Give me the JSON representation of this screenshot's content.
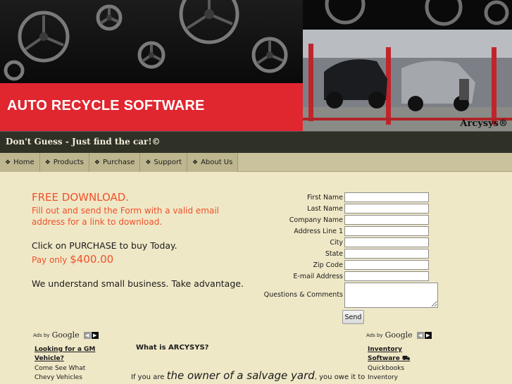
{
  "header": {
    "brand_title": "AUTO RECYCLE SOFTWARE",
    "photo_brand": "Arcysys®"
  },
  "slogan": "Don't Guess - Just find the car!©",
  "nav": {
    "items": [
      {
        "label": "Home"
      },
      {
        "label": "Products"
      },
      {
        "label": "Purchase"
      },
      {
        "label": "Support"
      },
      {
        "label": "About Us"
      }
    ]
  },
  "promo": {
    "free_download": "FREE DOWNLOAD.",
    "fill_line_1": "Fill out and send the Form with a valid email",
    "fill_line_2": "address for a link to download.",
    "click_purchase": "Click on PURCHASE to buy Today.",
    "pay_only": "Pay only",
    "price": "$400.00",
    "small_business": "We understand small business. Take advantage."
  },
  "form": {
    "fields": [
      {
        "label": "First Name",
        "value": ""
      },
      {
        "label": "Last Name",
        "value": ""
      },
      {
        "label": "Company Name",
        "value": ""
      },
      {
        "label": "Address Line 1",
        "value": ""
      },
      {
        "label": "City",
        "value": ""
      },
      {
        "label": "State",
        "value": ""
      },
      {
        "label": "Zip Code",
        "value": ""
      },
      {
        "label": "E-mail Address",
        "value": ""
      }
    ],
    "comments_label": "Questions & Comments",
    "send_label": "Send"
  },
  "ads_left": {
    "ads_by": "Ads by",
    "google": "Google",
    "link_line_1": "Looking for a GM",
    "link_line_2": "Vehicle?",
    "text_1": "Come See What",
    "text_2": "Chevy Vehicles"
  },
  "ads_right": {
    "ads_by": "Ads by",
    "google": "Google",
    "link_line_1": "Inventory",
    "link_line_2": "Software",
    "text_1": "Quickbooks",
    "text_2": "Inventory"
  },
  "main": {
    "what_is": "What is ARCYSYS?",
    "owner_pre": "If you are ",
    "owner_big": "the owner of a salvage yard",
    "owner_post": ", you owe it to"
  },
  "colors": {
    "brand_red": "#e0262f",
    "accent_orange": "#f0502a",
    "page_bg": "#efe8c7",
    "nav_bg": "#bdb68f",
    "slogan_bg": "#2f3127"
  }
}
